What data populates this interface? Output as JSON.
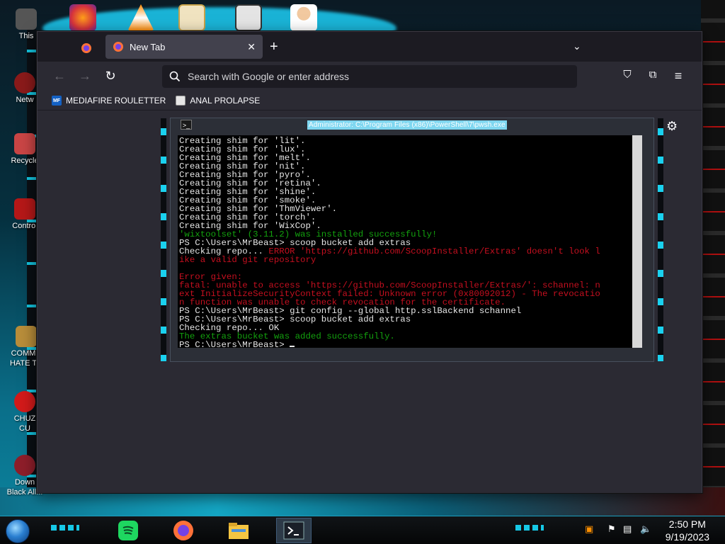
{
  "desktop": {
    "icons": [
      {
        "label": "This"
      },
      {
        "label": "Netw"
      },
      {
        "label": "Recycle"
      },
      {
        "label": "Control"
      },
      {
        "label": "COMMU\nHATE TH"
      },
      {
        "label": "CHUZ\nCU"
      },
      {
        "label": "Down\nBlack All..."
      }
    ]
  },
  "browser": {
    "tab": {
      "title": "New Tab",
      "close": "✕"
    },
    "new_tab_symbol": "+",
    "tab_list_symbol": "⌄",
    "nav": {
      "back": "←",
      "forward": "→",
      "reload": "↻"
    },
    "urlbar": {
      "placeholder": "Search with Google or enter address"
    },
    "bookmarks": [
      {
        "label": "MEDIAFIRE ROULETTER",
        "fav_text": "MF",
        "fav_color": "#1461c4"
      },
      {
        "label": "ANAL PROLAPSE",
        "fav_text": "",
        "fav_color": "#e6e6e6"
      }
    ],
    "toolbar": {
      "pocket": "⛉",
      "extensions": "⧉",
      "menu": "≡",
      "settings": "⚙"
    }
  },
  "terminal": {
    "title": "Administrator: C:\\Program Files (x86)\\PowerShell\\7\\pwsh.exe",
    "icon_text": ">_",
    "lines": [
      {
        "text": "Creating shim for 'lit'.",
        "color": "white"
      },
      {
        "text": "Creating shim for 'lux'.",
        "color": "white"
      },
      {
        "text": "Creating shim for 'melt'.",
        "color": "white"
      },
      {
        "text": "Creating shim for 'nit'.",
        "color": "white"
      },
      {
        "text": "Creating shim for 'pyro'.",
        "color": "white"
      },
      {
        "text": "Creating shim for 'retina'.",
        "color": "white"
      },
      {
        "text": "Creating shim for 'shine'.",
        "color": "white"
      },
      {
        "text": "Creating shim for 'smoke'.",
        "color": "white"
      },
      {
        "text": "Creating shim for 'ThmViewer'.",
        "color": "white"
      },
      {
        "text": "Creating shim for 'torch'.",
        "color": "white"
      },
      {
        "text": "Creating shim for 'WixCop'.",
        "color": "white"
      },
      {
        "text": "'wixtoolset' (3.11.2) was installed successfully!",
        "color": "green"
      },
      {
        "text": "PS C:\\Users\\MrBeast> scoop bucket add extras",
        "color": "white"
      },
      {
        "parts": [
          {
            "text": "Checking repo... ",
            "color": "white"
          },
          {
            "text": "ERROR 'https://github.com/ScoopInstaller/Extras' doesn't look l",
            "color": "red"
          }
        ]
      },
      {
        "text": "ike a valid git repository",
        "color": "red"
      },
      {
        "text": "",
        "color": "white"
      },
      {
        "text": "Error given:",
        "color": "red"
      },
      {
        "text": "fatal: unable to access 'https://github.com/ScoopInstaller/Extras/': schannel: n",
        "color": "red"
      },
      {
        "text": "ext InitializeSecurityContext failed: Unknown error (0x80092012) - The revocatio",
        "color": "red"
      },
      {
        "text": "n function was unable to check revocation for the certificate.",
        "color": "red"
      },
      {
        "text": "PS C:\\Users\\MrBeast> git config --global http.sslBackend schannel",
        "color": "white"
      },
      {
        "text": "PS C:\\Users\\MrBeast> scoop bucket add extras",
        "color": "white"
      },
      {
        "text": "Checking repo... OK",
        "color": "white"
      },
      {
        "text": "The extras bucket was added successfully.",
        "color": "green"
      },
      {
        "text": "PS C:\\Users\\MrBeast> ",
        "color": "white",
        "cursor": true
      }
    ]
  },
  "taskbar": {
    "apps": [
      {
        "name": "spotify",
        "color": "#1ed760"
      },
      {
        "name": "firefox",
        "color": "#ff7139"
      },
      {
        "name": "file-explorer",
        "color": "#f4c542"
      },
      {
        "name": "powershell",
        "color": "#2d3a48"
      }
    ],
    "clock": {
      "time": "2:50 PM",
      "date": "9/19/2023"
    }
  }
}
